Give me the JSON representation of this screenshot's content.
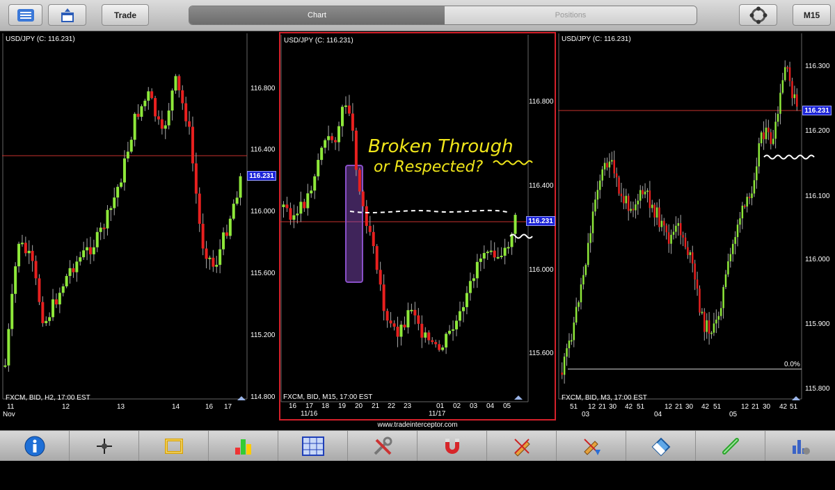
{
  "toolbar": {
    "trade_label": "Trade",
    "tab_chart": "Chart",
    "tab_positions": "Positions",
    "timeframe_label": "M15"
  },
  "panels": [
    {
      "title": "USD/JPY (C: 116.231)",
      "footer": "FXCM, BID, H2, 17:00 EST",
      "price_tag": "116.231",
      "y_labels": [
        "116.800",
        "116.400",
        "116.000",
        "115.600",
        "115.200",
        "114.800"
      ],
      "x_labels": [
        "11",
        "12",
        "13",
        "14",
        "16",
        "17"
      ],
      "x_sublabels": [
        "Nov"
      ]
    },
    {
      "title": "USD/JPY (C: 116.231)",
      "footer": "FXCM, BID, M15, 17:00 EST",
      "price_tag": "116.231",
      "y_labels": [
        "116.800",
        "116.400",
        "116.000",
        "115.600"
      ],
      "x_labels": [
        "16",
        "17",
        "18",
        "19",
        "20",
        "21",
        "22",
        "23",
        "01",
        "02",
        "03",
        "04",
        "05"
      ],
      "x_sublabels": [
        "11/16",
        "11/17"
      ]
    },
    {
      "title": "USD/JPY (C: 116.231)",
      "footer": "FXCM, BID, M3, 17:00 EST",
      "price_tag": "116.231",
      "y_labels": [
        "116.300",
        "116.200",
        "116.100",
        "116.000",
        "115.900",
        "115.800"
      ],
      "x_labels": [
        "51",
        "12",
        "21",
        "30",
        "42",
        "51",
        "12",
        "21",
        "30",
        "42",
        "51",
        "12",
        "21",
        "30",
        "42",
        "51"
      ],
      "x_sublabels": [
        "03",
        "04",
        "05"
      ],
      "fib_label": "0.0%"
    }
  ],
  "annotation": {
    "line1": "Broken Through",
    "line2": "or Respected?"
  },
  "website": "www.tradeinterceptor.com",
  "bottom_icons": [
    "info-icon",
    "crosshair-icon",
    "ruler-frame-icon",
    "indicators-icon",
    "grid-icon",
    "tools-icon",
    "magnet-icon",
    "draw-pencil-icon",
    "draw-pencil-arrow-icon",
    "eraser-icon",
    "link-icon",
    "chart-settings-icon"
  ],
  "colors": {
    "bull": "#8ee83a",
    "bear": "#e8201f",
    "price_line": "#c8322e",
    "active_panel_border": "#d5202a",
    "price_tag": "#1b23d8",
    "annotation": "#f1e71a"
  }
}
